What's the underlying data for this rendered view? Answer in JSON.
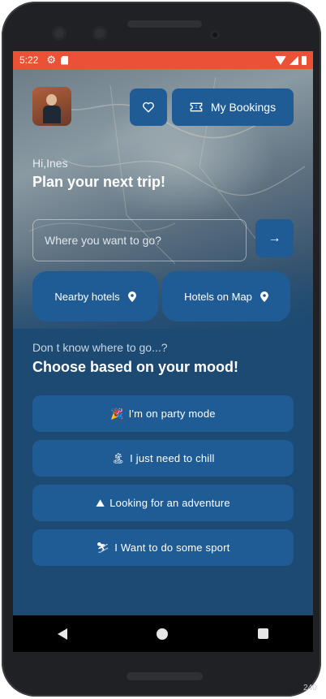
{
  "status_bar": {
    "time": "5:22"
  },
  "header": {
    "favorites_icon": "heart-icon",
    "bookings_icon": "ticket-icon",
    "bookings_label": "My Bookings"
  },
  "greeting": {
    "hello": "Hi,Ines",
    "headline": "Plan your next trip!"
  },
  "search": {
    "placeholder": "Where you want to go?",
    "go_icon": "arrow-right-icon"
  },
  "quick_actions": [
    {
      "label": "Nearby hotels",
      "icon": "location-pin-icon"
    },
    {
      "label": "Hotels on Map",
      "icon": "location-pin-icon"
    }
  ],
  "mood": {
    "question": "Don t know where to go...?",
    "title": "Choose based on your mood!",
    "options": [
      {
        "emoji": "🎉",
        "label": "I'm on party mode"
      },
      {
        "emoji": "🏝",
        "label": "I just need to chill"
      },
      {
        "emoji": "⛰",
        "label": "Looking for an adventure"
      },
      {
        "emoji": "⛷",
        "label": "I Want to do some sport"
      }
    ]
  },
  "colors": {
    "status_bar": "#ea5136",
    "background": "#1c4a73",
    "button": "#1f5c96",
    "text": "#ffffff"
  },
  "edge_label": "240"
}
